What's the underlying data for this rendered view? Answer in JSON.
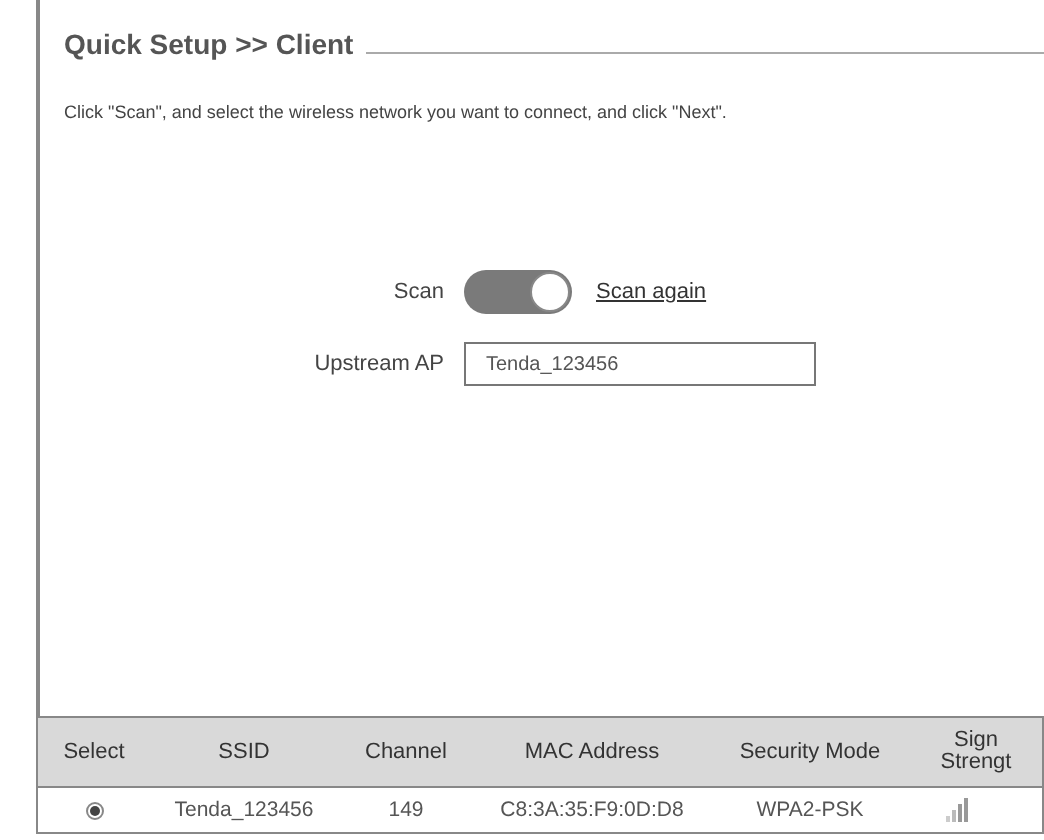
{
  "title": "Quick Setup >> Client",
  "description": "Click \"Scan\", and select the wireless network you want to connect, and click \"Next\".",
  "scan": {
    "label": "Scan",
    "on": true,
    "link": "Scan again"
  },
  "upstream_ap": {
    "label": "Upstream AP",
    "value": "Tenda_123456"
  },
  "table": {
    "columns": [
      {
        "lines": [
          "Select"
        ]
      },
      {
        "lines": [
          "SSID"
        ]
      },
      {
        "lines": [
          "Channel"
        ]
      },
      {
        "lines": [
          "MAC Address"
        ]
      },
      {
        "lines": [
          "Security Mode"
        ]
      },
      {
        "lines": [
          "Sign",
          "Strengt"
        ]
      }
    ],
    "rows": [
      {
        "selected": true,
        "ssid": "Tenda_123456",
        "channel": "149",
        "mac": "C8:3A:35:F9:0D:D8",
        "security": "WPA2-PSK"
      }
    ]
  }
}
